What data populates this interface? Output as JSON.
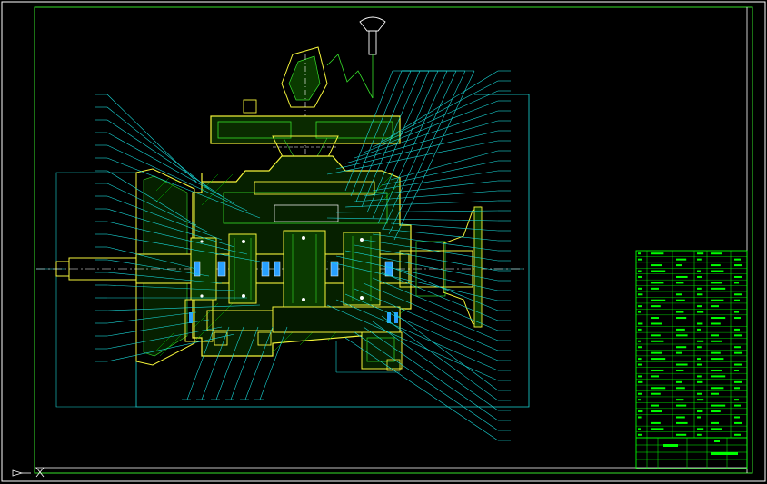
{
  "canvas": {
    "background": "#000000"
  },
  "colors": {
    "frame": "#ffffff",
    "outline": "#f5f53a",
    "outline_green": "#36e02a",
    "leader": "#19d8d8",
    "hatch": "#00c000",
    "bearing": "#28a0ff",
    "table_line": "#00ff00",
    "table_text": "#00ff00"
  },
  "drawing": {
    "subject": "gearbox-assembly-section",
    "balloon_count_left": 22,
    "balloon_count_right": 38,
    "balloon_count_bottom": 6
  },
  "title_block": {
    "parts_list_rows": 32,
    "title_rows": 4
  }
}
